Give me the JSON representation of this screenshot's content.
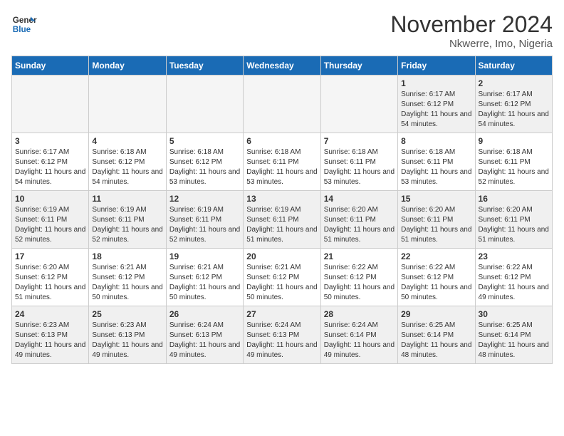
{
  "header": {
    "logo_general": "General",
    "logo_blue": "Blue",
    "month_title": "November 2024",
    "location": "Nkwerre, Imo, Nigeria"
  },
  "days_of_week": [
    "Sunday",
    "Monday",
    "Tuesday",
    "Wednesday",
    "Thursday",
    "Friday",
    "Saturday"
  ],
  "weeks": [
    [
      {
        "day": "",
        "info": ""
      },
      {
        "day": "",
        "info": ""
      },
      {
        "day": "",
        "info": ""
      },
      {
        "day": "",
        "info": ""
      },
      {
        "day": "",
        "info": ""
      },
      {
        "day": "1",
        "info": "Sunrise: 6:17 AM\nSunset: 6:12 PM\nDaylight: 11 hours and 54 minutes."
      },
      {
        "day": "2",
        "info": "Sunrise: 6:17 AM\nSunset: 6:12 PM\nDaylight: 11 hours and 54 minutes."
      }
    ],
    [
      {
        "day": "3",
        "info": "Sunrise: 6:17 AM\nSunset: 6:12 PM\nDaylight: 11 hours and 54 minutes."
      },
      {
        "day": "4",
        "info": "Sunrise: 6:18 AM\nSunset: 6:12 PM\nDaylight: 11 hours and 54 minutes."
      },
      {
        "day": "5",
        "info": "Sunrise: 6:18 AM\nSunset: 6:12 PM\nDaylight: 11 hours and 53 minutes."
      },
      {
        "day": "6",
        "info": "Sunrise: 6:18 AM\nSunset: 6:11 PM\nDaylight: 11 hours and 53 minutes."
      },
      {
        "day": "7",
        "info": "Sunrise: 6:18 AM\nSunset: 6:11 PM\nDaylight: 11 hours and 53 minutes."
      },
      {
        "day": "8",
        "info": "Sunrise: 6:18 AM\nSunset: 6:11 PM\nDaylight: 11 hours and 53 minutes."
      },
      {
        "day": "9",
        "info": "Sunrise: 6:18 AM\nSunset: 6:11 PM\nDaylight: 11 hours and 52 minutes."
      }
    ],
    [
      {
        "day": "10",
        "info": "Sunrise: 6:19 AM\nSunset: 6:11 PM\nDaylight: 11 hours and 52 minutes."
      },
      {
        "day": "11",
        "info": "Sunrise: 6:19 AM\nSunset: 6:11 PM\nDaylight: 11 hours and 52 minutes."
      },
      {
        "day": "12",
        "info": "Sunrise: 6:19 AM\nSunset: 6:11 PM\nDaylight: 11 hours and 52 minutes."
      },
      {
        "day": "13",
        "info": "Sunrise: 6:19 AM\nSunset: 6:11 PM\nDaylight: 11 hours and 51 minutes."
      },
      {
        "day": "14",
        "info": "Sunrise: 6:20 AM\nSunset: 6:11 PM\nDaylight: 11 hours and 51 minutes."
      },
      {
        "day": "15",
        "info": "Sunrise: 6:20 AM\nSunset: 6:11 PM\nDaylight: 11 hours and 51 minutes."
      },
      {
        "day": "16",
        "info": "Sunrise: 6:20 AM\nSunset: 6:11 PM\nDaylight: 11 hours and 51 minutes."
      }
    ],
    [
      {
        "day": "17",
        "info": "Sunrise: 6:20 AM\nSunset: 6:12 PM\nDaylight: 11 hours and 51 minutes."
      },
      {
        "day": "18",
        "info": "Sunrise: 6:21 AM\nSunset: 6:12 PM\nDaylight: 11 hours and 50 minutes."
      },
      {
        "day": "19",
        "info": "Sunrise: 6:21 AM\nSunset: 6:12 PM\nDaylight: 11 hours and 50 minutes."
      },
      {
        "day": "20",
        "info": "Sunrise: 6:21 AM\nSunset: 6:12 PM\nDaylight: 11 hours and 50 minutes."
      },
      {
        "day": "21",
        "info": "Sunrise: 6:22 AM\nSunset: 6:12 PM\nDaylight: 11 hours and 50 minutes."
      },
      {
        "day": "22",
        "info": "Sunrise: 6:22 AM\nSunset: 6:12 PM\nDaylight: 11 hours and 50 minutes."
      },
      {
        "day": "23",
        "info": "Sunrise: 6:22 AM\nSunset: 6:12 PM\nDaylight: 11 hours and 49 minutes."
      }
    ],
    [
      {
        "day": "24",
        "info": "Sunrise: 6:23 AM\nSunset: 6:13 PM\nDaylight: 11 hours and 49 minutes."
      },
      {
        "day": "25",
        "info": "Sunrise: 6:23 AM\nSunset: 6:13 PM\nDaylight: 11 hours and 49 minutes."
      },
      {
        "day": "26",
        "info": "Sunrise: 6:24 AM\nSunset: 6:13 PM\nDaylight: 11 hours and 49 minutes."
      },
      {
        "day": "27",
        "info": "Sunrise: 6:24 AM\nSunset: 6:13 PM\nDaylight: 11 hours and 49 minutes."
      },
      {
        "day": "28",
        "info": "Sunrise: 6:24 AM\nSunset: 6:14 PM\nDaylight: 11 hours and 49 minutes."
      },
      {
        "day": "29",
        "info": "Sunrise: 6:25 AM\nSunset: 6:14 PM\nDaylight: 11 hours and 48 minutes."
      },
      {
        "day": "30",
        "info": "Sunrise: 6:25 AM\nSunset: 6:14 PM\nDaylight: 11 hours and 48 minutes."
      }
    ]
  ]
}
